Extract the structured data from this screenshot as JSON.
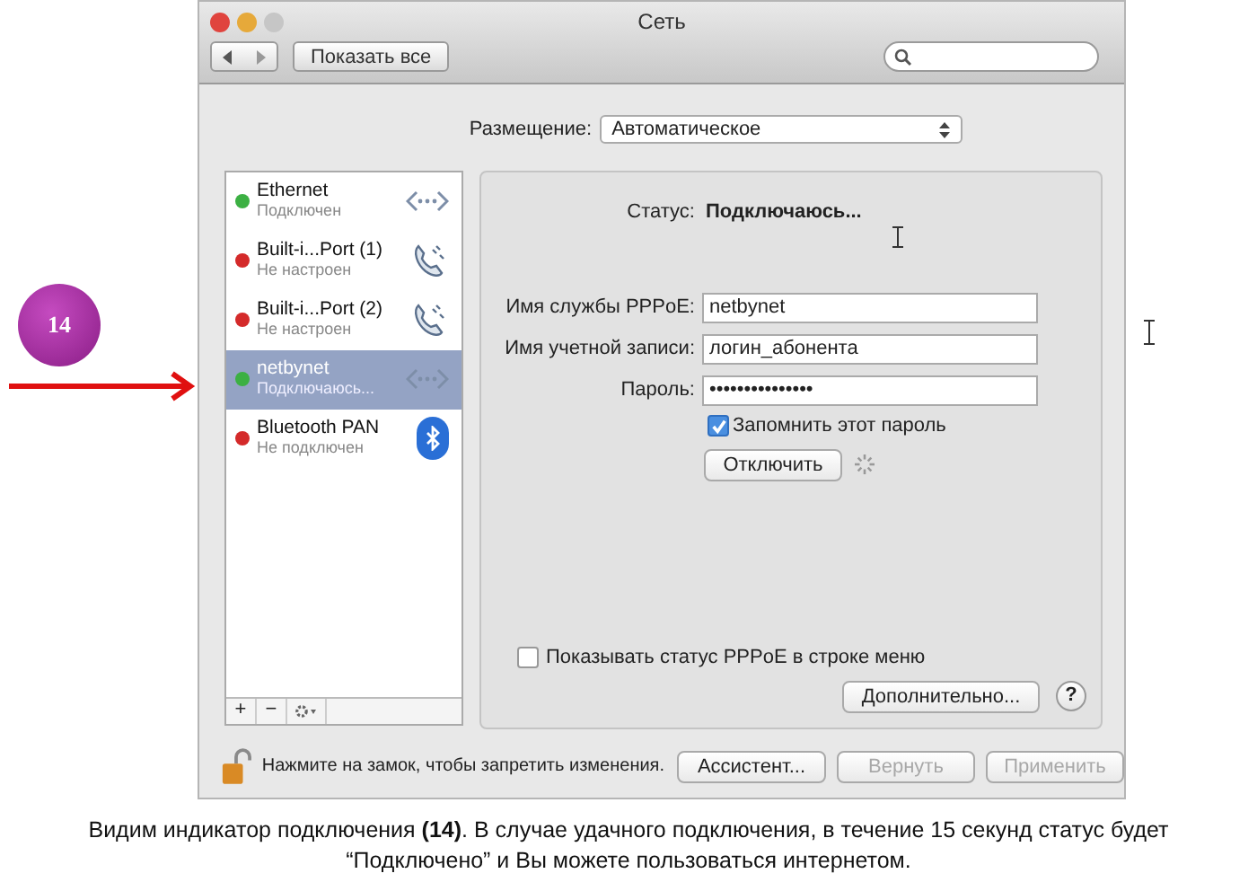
{
  "window": {
    "title": "Сеть"
  },
  "toolbar": {
    "show_all": "Показать все"
  },
  "location": {
    "label": "Размещение:",
    "value": "Автоматическое"
  },
  "services": [
    {
      "name": "Ethernet",
      "status": "Подключен",
      "color": "#3cb043",
      "kind": "ethernet",
      "selected": false
    },
    {
      "name": "Built-i...Port (1)",
      "status": "Не настроен",
      "color": "#d42a2a",
      "kind": "phone",
      "selected": false
    },
    {
      "name": "Built-i...Port (2)",
      "status": "Не настроен",
      "color": "#d42a2a",
      "kind": "phone",
      "selected": false
    },
    {
      "name": "netbynet",
      "status": "Подключаюсь...",
      "color": "#3cb043",
      "kind": "ethernet",
      "selected": true
    },
    {
      "name": "Bluetooth PAN",
      "status": "Не подключен",
      "color": "#d42a2a",
      "kind": "bluetooth",
      "selected": false
    }
  ],
  "list_buttons": [
    "+",
    "−"
  ],
  "details": {
    "status_label": "Статус:",
    "status_value": "Подключаюсь...",
    "fields": [
      {
        "label": "Имя службы PPPoE:",
        "value": "netbynet"
      },
      {
        "label": "Имя учетной записи:",
        "value": "логин_абонента"
      },
      {
        "label": "Пароль:",
        "value": "•••••••••••••••"
      }
    ],
    "remember": {
      "label": "Запомнить этот пароль",
      "checked": true
    },
    "disconnect": "Отключить",
    "show_status": {
      "label": "Показывать статус PPPoE в строке меню",
      "checked": false
    },
    "advanced": "Дополнительно...",
    "help": "?"
  },
  "footer": {
    "lock_text": "Нажмите на замок, чтобы запретить изменения.",
    "buttons": [
      {
        "label": "Ассистент...",
        "disabled": false
      },
      {
        "label": "Вернуть",
        "disabled": true
      },
      {
        "label": "Применить",
        "disabled": true
      }
    ]
  },
  "annotation": {
    "badge": "14"
  },
  "caption": "Видим индикатор подключения **(14)**. В случае удачного подключения, в течение 15 секунд статус будет “Подключено” и Вы можете пользоваться интернетом."
}
